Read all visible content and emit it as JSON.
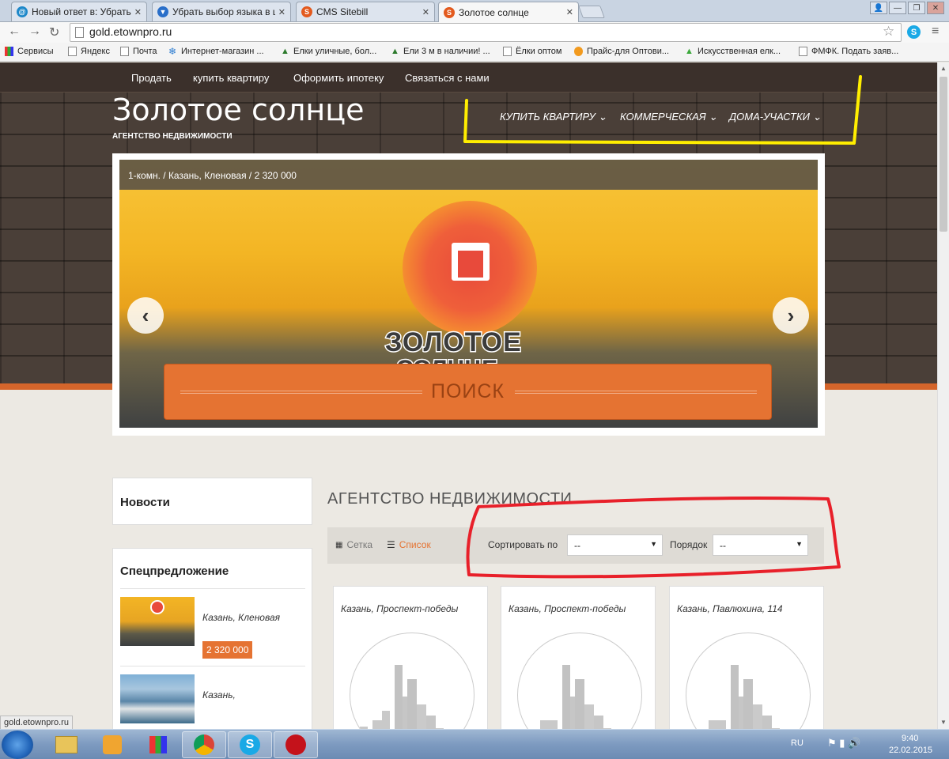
{
  "browser": {
    "tabs": [
      {
        "title": "Новый ответ в: Убрать вы",
        "icon": "email-icon",
        "color": "#1e88c9"
      },
      {
        "title": "Убрать выбор языка в ш",
        "icon": "forum-icon",
        "color": "#2a6fc9"
      },
      {
        "title": "CMS Sitebill",
        "icon": "sitebill-icon",
        "color": "#e35a1e"
      },
      {
        "title": "Золотое солнце",
        "icon": "sitebill-icon",
        "color": "#e35a1e"
      }
    ],
    "url": "gold.etownpro.ru",
    "bookmarks": [
      {
        "label": "Сервисы",
        "icon": "apps-icon"
      },
      {
        "label": "Яндекс",
        "icon": "page-icon"
      },
      {
        "label": "Почта",
        "icon": "page-icon"
      },
      {
        "label": "Интернет-магазин ...",
        "icon": "snowflake-icon"
      },
      {
        "label": "Елки уличные, бол...",
        "icon": "tree-icon"
      },
      {
        "label": "Ели 3 м в наличии! ...",
        "icon": "tree-icon"
      },
      {
        "label": "Ёлки оптом",
        "icon": "page-icon"
      },
      {
        "label": "Прайс-для Оптови...",
        "icon": "email-icon"
      },
      {
        "label": "Искусственная елк...",
        "icon": "tree-icon"
      },
      {
        "label": "ФМФК. Подать заяв...",
        "icon": "page-icon"
      }
    ],
    "status_url": "gold.etownpro.ru"
  },
  "site": {
    "topnav": [
      "Продать",
      "купить квартиру",
      "Оформить ипотеку",
      "Связаться с нами"
    ],
    "logo": "Золотое солнце",
    "tagline": "АГЕНТСТВО НЕДВИЖИМОСТИ",
    "mainnav": [
      "КУПИТЬ КВАРТИРУ",
      "КОММЕРЧЕСКАЯ",
      "ДОМА-УЧАСТКИ"
    ],
    "slider": {
      "caption": "1-комн. / Казань, Кленовая / 2 320 000",
      "brand_line1": "ЗОЛОТОЕ",
      "brand_line2": "СОЛНЦЕ",
      "search_label": "ПОИСК"
    },
    "sidebar": {
      "news_title": "Новости",
      "special_title": "Спецпредложение",
      "specials": [
        {
          "address": "Казань, Кленовая",
          "price": "2 320 000"
        },
        {
          "address": "Казань,",
          "price": ""
        }
      ]
    },
    "main": {
      "title": "АГЕНТСТВО НЕДВИЖИМОСТИ",
      "view_grid": "Сетка",
      "view_list": "Список",
      "sort_label": "Сортировать по",
      "sort_value": "--",
      "order_label": "Порядок",
      "order_value": "--",
      "cards": [
        {
          "address": "Казань, Проспект-победы"
        },
        {
          "address": "Казань, Проспект-победы"
        },
        {
          "address": "Казань, Павлюхина, 114"
        }
      ]
    }
  },
  "taskbar": {
    "lang": "RU",
    "time": "9:40",
    "date": "22.02.2015"
  },
  "colors": {
    "accent": "#e57332",
    "header": "#3b302b",
    "yellow_annotation": "#ffee00",
    "red_annotation": "#e8202a"
  }
}
